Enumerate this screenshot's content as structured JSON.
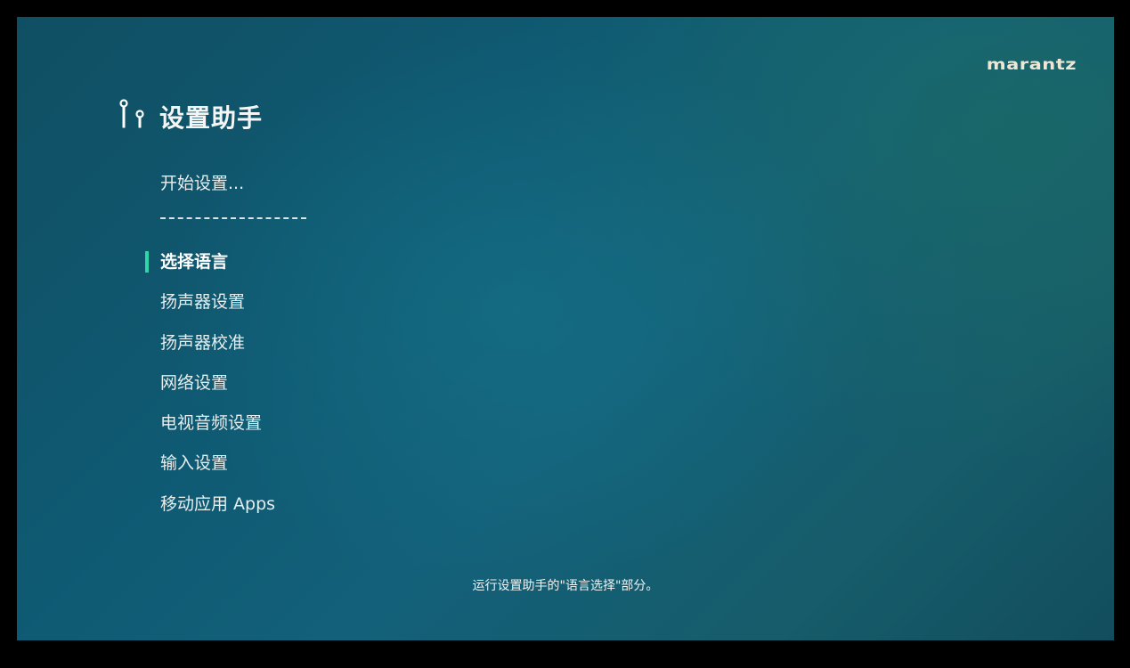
{
  "brand": {
    "logo_text": "marantz"
  },
  "header": {
    "icon": "setup-wizard-icon",
    "title": "设置助手"
  },
  "intro": {
    "label": "开始设置...",
    "separator": "------------------------"
  },
  "menu": {
    "selected_index": 0,
    "items": [
      {
        "label": "选择语言"
      },
      {
        "label": "扬声器设置"
      },
      {
        "label": "扬声器校准"
      },
      {
        "label": "网络设置"
      },
      {
        "label": "电视音频设置"
      },
      {
        "label": "输入设置"
      },
      {
        "label": "移动应用 Apps"
      }
    ]
  },
  "footer": {
    "help_text": "运行设置助手的\"语言选择\"部分。"
  },
  "colors": {
    "background": "#0f5a73",
    "selection_marker": "#2fd6a8",
    "logo": "#efe7d6",
    "text": "#e7eded"
  }
}
